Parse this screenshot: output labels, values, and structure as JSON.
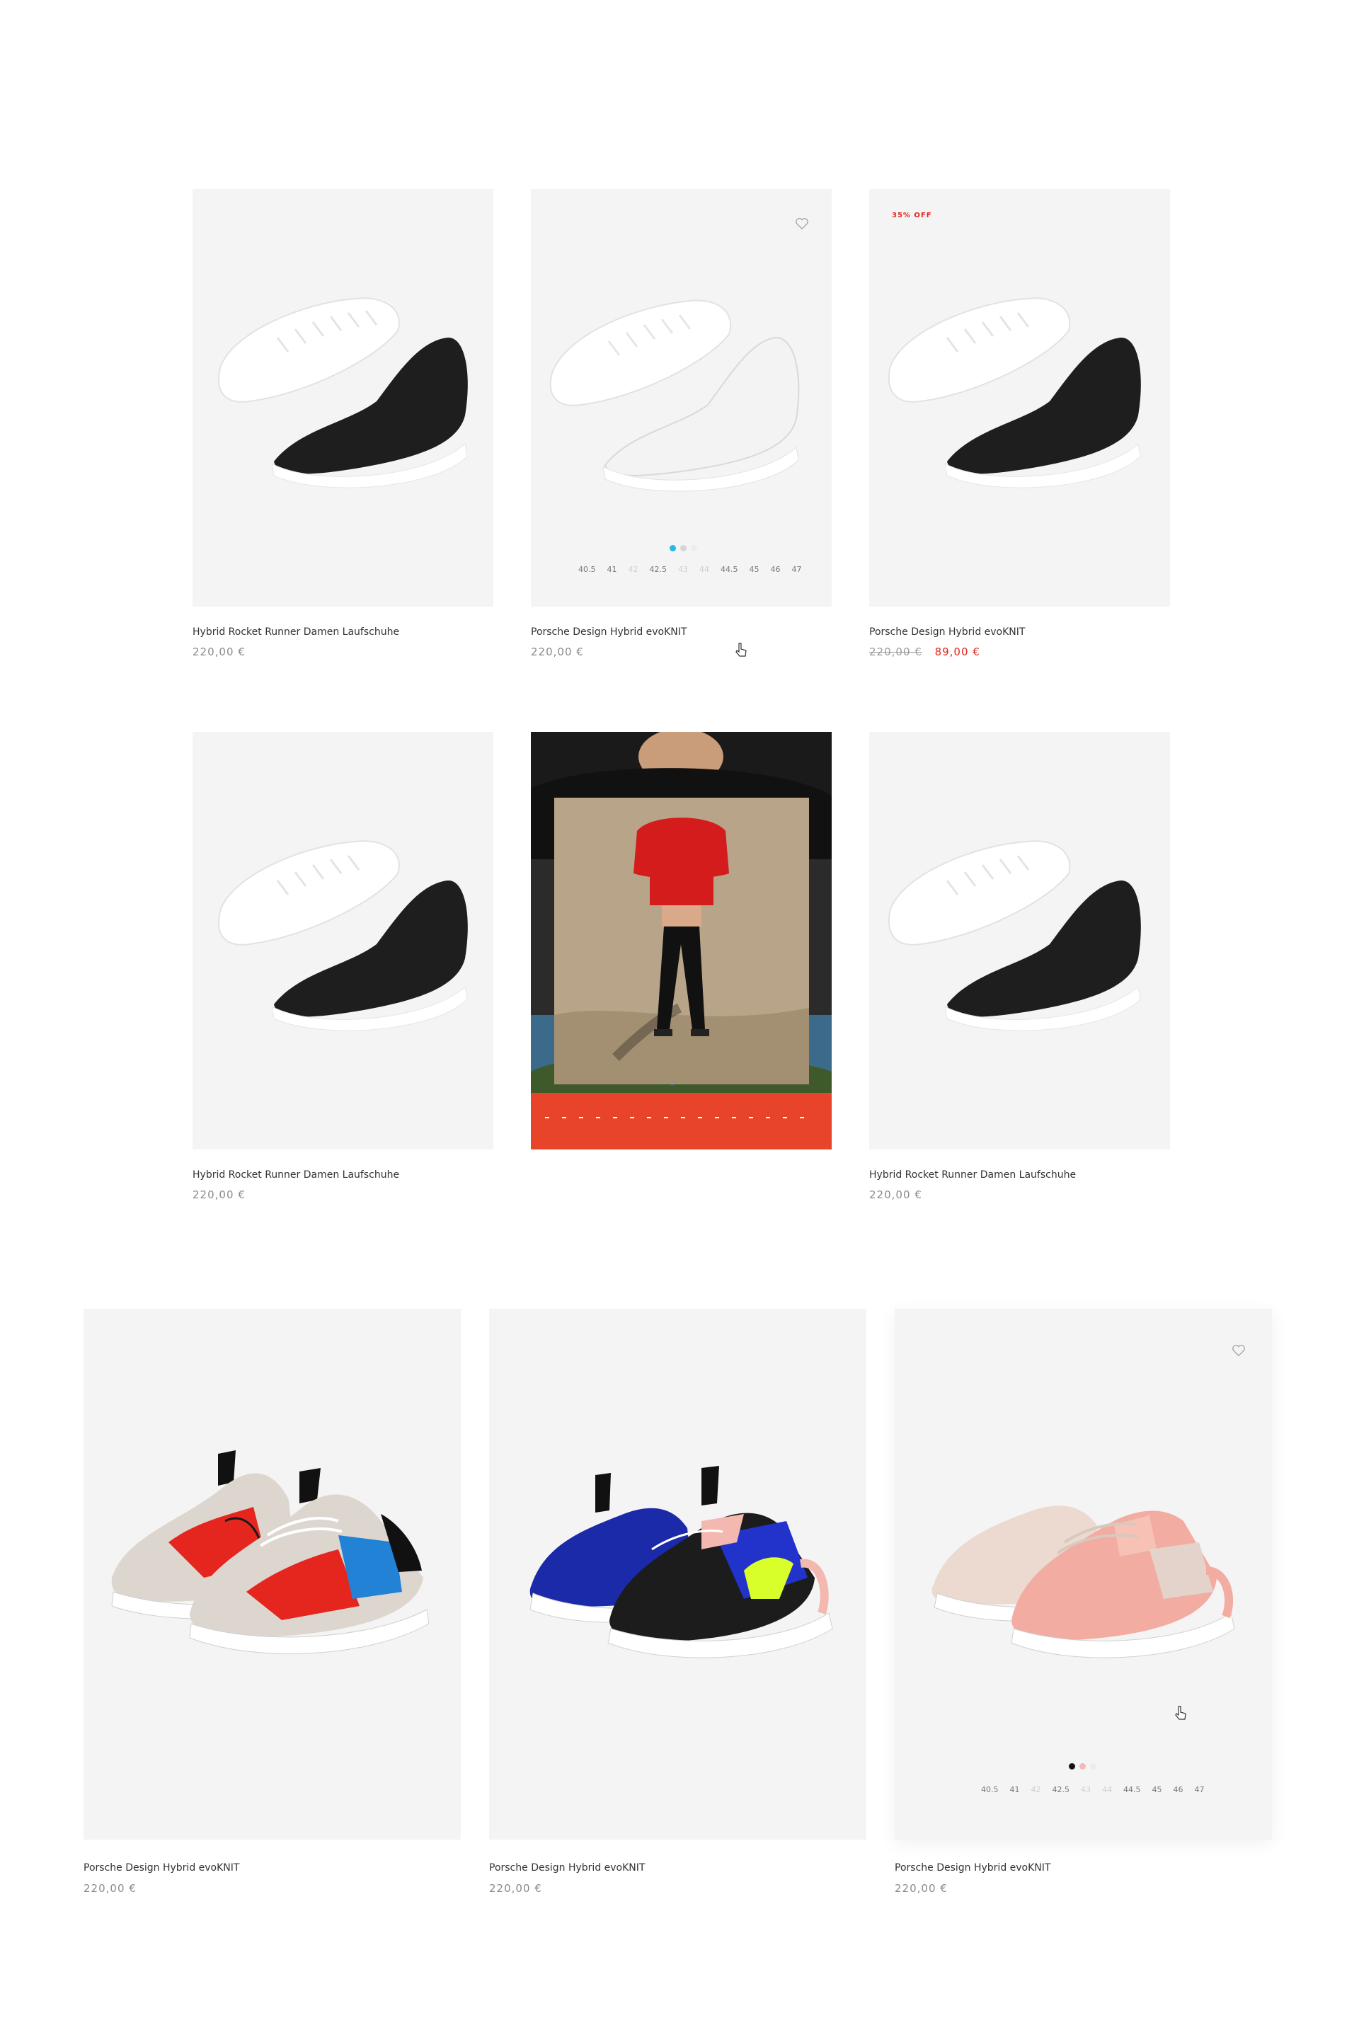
{
  "products": [
    {
      "title": "Hybrid Rocket Runner Damen Laufschuhe",
      "price": "220,00 €"
    },
    {
      "title": "Porsche Design Hybrid evoKNIT",
      "price": "220,00 €",
      "sizes": [
        {
          "s": "40.5",
          "na": false
        },
        {
          "s": "41",
          "na": false
        },
        {
          "s": "42",
          "na": true
        },
        {
          "s": "42.5",
          "na": false
        },
        {
          "s": "43",
          "na": true
        },
        {
          "s": "44",
          "na": true
        },
        {
          "s": "44.5",
          "na": false
        },
        {
          "s": "45",
          "na": false
        },
        {
          "s": "46",
          "na": false
        },
        {
          "s": "47",
          "na": false
        }
      ]
    },
    {
      "title": "Porsche Design Hybrid evoKNIT",
      "old_price": "220,00 €",
      "sale_price": "89,00 €",
      "badge": "35% OFF"
    },
    {
      "title": "Hybrid Rocket Runner Damen Laufschuhe",
      "price": "220,00 €"
    },
    {
      "title": "Hybrid Rocket Runner Damen Laufschuhe",
      "price": "220,00 €"
    },
    {
      "title": "Porsche Design Hybrid evoKNIT",
      "price": "220,00 €"
    },
    {
      "title": "Porsche Design Hybrid evoKNIT",
      "price": "220,00 €"
    },
    {
      "title": "Porsche Design Hybrid evoKNIT",
      "price": "220,00 €",
      "sizes": [
        {
          "s": "40.5",
          "na": false
        },
        {
          "s": "41",
          "na": false
        },
        {
          "s": "42",
          "na": true
        },
        {
          "s": "42.5",
          "na": false
        },
        {
          "s": "43",
          "na": true
        },
        {
          "s": "44",
          "na": true
        },
        {
          "s": "44.5",
          "na": false
        },
        {
          "s": "45",
          "na": false
        },
        {
          "s": "46",
          "na": false
        },
        {
          "s": "47",
          "na": false
        }
      ]
    }
  ],
  "colors": {
    "card_bg": "#f4f4f4",
    "sale": "#e1261c",
    "dot_active_blue": "#29b6e8",
    "dot_active_black": "#111111",
    "dot_pink": "#f2b9b9"
  },
  "icons": [
    "heart-icon",
    "pointer-cursor-icon"
  ]
}
